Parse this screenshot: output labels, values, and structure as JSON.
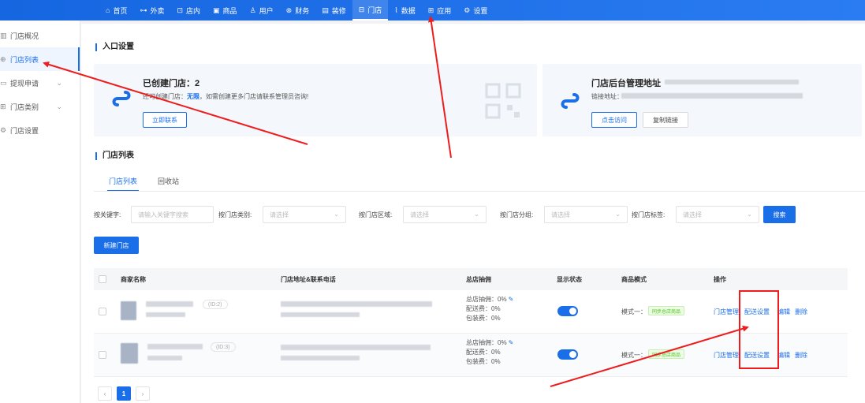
{
  "topnav": [
    {
      "label": "首页",
      "icon": "home-icon",
      "glyph": "⌂"
    },
    {
      "label": "外卖",
      "icon": "delivery-icon",
      "glyph": "⊶"
    },
    {
      "label": "店内",
      "icon": "dine-in-icon",
      "glyph": "⊡"
    },
    {
      "label": "商品",
      "icon": "goods-icon",
      "glyph": "▣"
    },
    {
      "label": "用户",
      "icon": "user-icon",
      "glyph": "♙"
    },
    {
      "label": "财务",
      "icon": "finance-icon",
      "glyph": "⊗"
    },
    {
      "label": "装修",
      "icon": "decorate-icon",
      "glyph": "▤"
    },
    {
      "label": "门店",
      "icon": "store-icon",
      "glyph": "⊟"
    },
    {
      "label": "数据",
      "icon": "chart-icon",
      "glyph": "⌇"
    },
    {
      "label": "应用",
      "icon": "apps-icon",
      "glyph": "⊞"
    },
    {
      "label": "设置",
      "icon": "settings-icon",
      "glyph": "⚙"
    }
  ],
  "sidebar": [
    {
      "label": "门店概况",
      "glyph": "▥"
    },
    {
      "label": "门店列表",
      "glyph": "⊕"
    },
    {
      "label": "提现申请",
      "glyph": "▭",
      "chev": "⌄"
    },
    {
      "label": "门店类别",
      "glyph": "⊞",
      "chev": "⌄"
    },
    {
      "label": "门店设置",
      "glyph": "⚙"
    }
  ],
  "entry": {
    "section_title": "入口设置",
    "left_card": {
      "title": "已创建门店：2",
      "text_pre": "还可创建门店：",
      "text_hl": "无限",
      "text_post": "，如需创建更多门店请联系管理员咨询!",
      "button": "立即联系"
    },
    "right_card": {
      "title": "门店后台管理地址",
      "link_label": "链接地址：",
      "visit_button": "点击访问",
      "copy_button": "复制链接"
    }
  },
  "list": {
    "section_title": "门店列表",
    "tabs": [
      "门店列表",
      "回收站"
    ],
    "filters": {
      "keyword_label": "按关键字:",
      "keyword_placeholder": "请输入关键字搜索",
      "category_label": "按门店类别:",
      "area_label": "按门店区域:",
      "group_label": "按门店分组:",
      "tag_label": "按门店标签:",
      "select_placeholder": "请选择",
      "search_button": "搜索"
    },
    "new_button": "新建门店",
    "columns": [
      "商家名称",
      "门店地址&联系电话",
      "总店抽佣",
      "显示状态",
      "商品模式",
      "操作"
    ],
    "rows": [
      {
        "id": "(ID:2)",
        "fees": [
          "总店抽佣：0%",
          "配送费：0%",
          "包装费：0%"
        ],
        "mode": "模式一：",
        "mode_tag": "同步总店商品",
        "ops": [
          "门店管理",
          "配送设置",
          "编辑",
          "删除"
        ]
      },
      {
        "id": "(ID:3)",
        "fees": [
          "总店抽佣：0%",
          "配送费：0%",
          "包装费：0%"
        ],
        "mode": "模式一：",
        "mode_tag": "同步总店商品",
        "ops": [
          "门店管理",
          "配送设置",
          "编辑",
          "删除"
        ]
      }
    ],
    "pager": {
      "prev": "‹",
      "page": "1",
      "next": "›"
    }
  },
  "colors": {
    "primary": "#1a6ee8",
    "annotation": "#ee1c1c"
  }
}
